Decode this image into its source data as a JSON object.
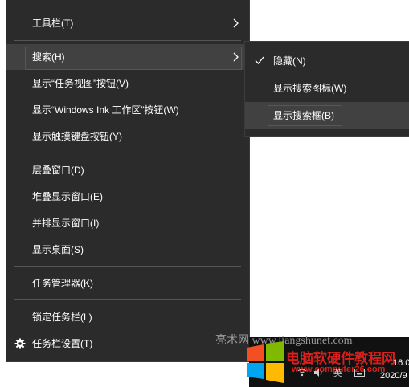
{
  "main_menu": {
    "toolbars": "工具栏(T)",
    "search": "搜索(H)",
    "show_task_view": "显示“任务视图”按钮(V)",
    "show_windows_ink": "显示“Windows Ink 工作区”按钮(W)",
    "show_touch_keyboard": "显示触摸键盘按钮(Y)",
    "cascade": "层叠窗口(D)",
    "stacked": "堆叠显示窗口(E)",
    "side_by_side": "并排显示窗口(I)",
    "show_desktop": "显示桌面(S)",
    "task_manager": "任务管理器(K)",
    "lock_taskbar": "锁定任务栏(L)",
    "taskbar_settings": "任务栏设置(T)"
  },
  "search_submenu": {
    "hidden": "隐藏(N)",
    "show_search_icon": "显示搜索图标(W)",
    "show_search_box": "显示搜索框(B)"
  },
  "watermark": {
    "site_text": "亮术网 www.liangshunet.com",
    "logo_text": "电脑软硬件教程网",
    "logo_url": "www.computer26.com"
  },
  "taskbar": {
    "input_lang": "英",
    "time": "16:0",
    "date": "2020/9"
  },
  "colors": {
    "menu_bg": "#2b2b2b",
    "menu_hover": "#414141",
    "highlight_border": "#d9201c"
  },
  "icons": {
    "submenu_arrow": "chevron-right-icon",
    "checked": "checkmark-icon",
    "settings": "gear-icon"
  }
}
